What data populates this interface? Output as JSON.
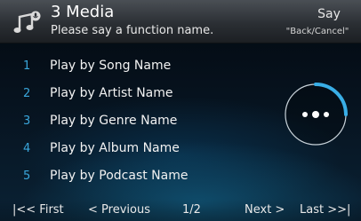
{
  "header": {
    "icon": "music-note-voice-icon",
    "title": "3 Media",
    "subtitle": "Please say a function name.",
    "say_label": "Say",
    "back_cancel_label": "\"Back/Cancel\""
  },
  "menu": {
    "items": [
      {
        "number": "1",
        "label": "Play by Song Name"
      },
      {
        "number": "2",
        "label": "Play by Artist Name"
      },
      {
        "number": "3",
        "label": "Play by Genre Name"
      },
      {
        "number": "4",
        "label": "Play by Album Name"
      },
      {
        "number": "5",
        "label": "Play by Podcast Name"
      }
    ]
  },
  "indicator": {
    "icon": "listening-dots-icon"
  },
  "footer": {
    "first": "|<< First",
    "previous": "< Previous",
    "page": "1/2",
    "next": "Next >",
    "last": "Last >>|"
  },
  "colors": {
    "accent": "#3aa7dc",
    "header_top": "#4a4f55",
    "header_bottom": "#1c1f23"
  }
}
